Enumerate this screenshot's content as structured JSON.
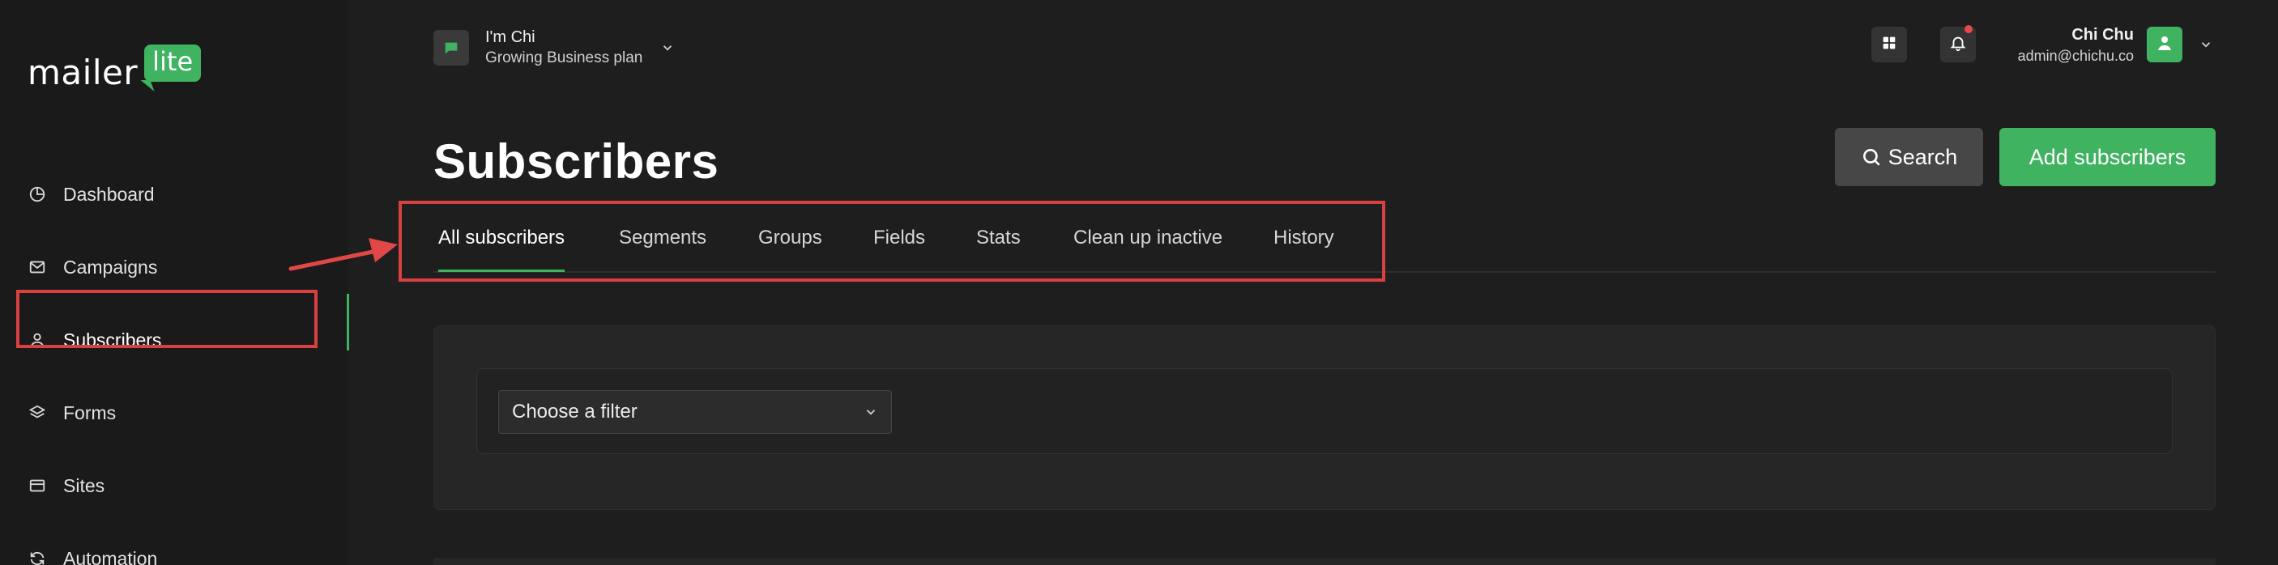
{
  "brand": {
    "logo_text": "mailer",
    "logo_badge": "lite",
    "accent": "#3fb35f"
  },
  "sidebar": {
    "items": [
      {
        "label": "Dashboard",
        "icon": "pie-chart-icon"
      },
      {
        "label": "Campaigns",
        "icon": "mail-icon"
      },
      {
        "label": "Subscribers",
        "icon": "user-icon",
        "active": true
      },
      {
        "label": "Forms",
        "icon": "layers-icon"
      },
      {
        "label": "Sites",
        "icon": "browser-icon"
      },
      {
        "label": "Automation",
        "icon": "refresh-icon"
      }
    ]
  },
  "account": {
    "name": "I'm Chi",
    "plan": "Growing Business plan"
  },
  "user": {
    "name": "Chi Chu",
    "email": "admin@chichu.co"
  },
  "page": {
    "title": "Subscribers",
    "search_label": "Search",
    "add_label": "Add subscribers"
  },
  "tabs": [
    {
      "label": "All subscribers",
      "active": true
    },
    {
      "label": "Segments"
    },
    {
      "label": "Groups"
    },
    {
      "label": "Fields"
    },
    {
      "label": "Stats"
    },
    {
      "label": "Clean up inactive"
    },
    {
      "label": "History"
    }
  ],
  "filter": {
    "placeholder": "Choose a filter"
  },
  "colors": {
    "annotation": "#d94141",
    "notification": "#e5484d"
  }
}
